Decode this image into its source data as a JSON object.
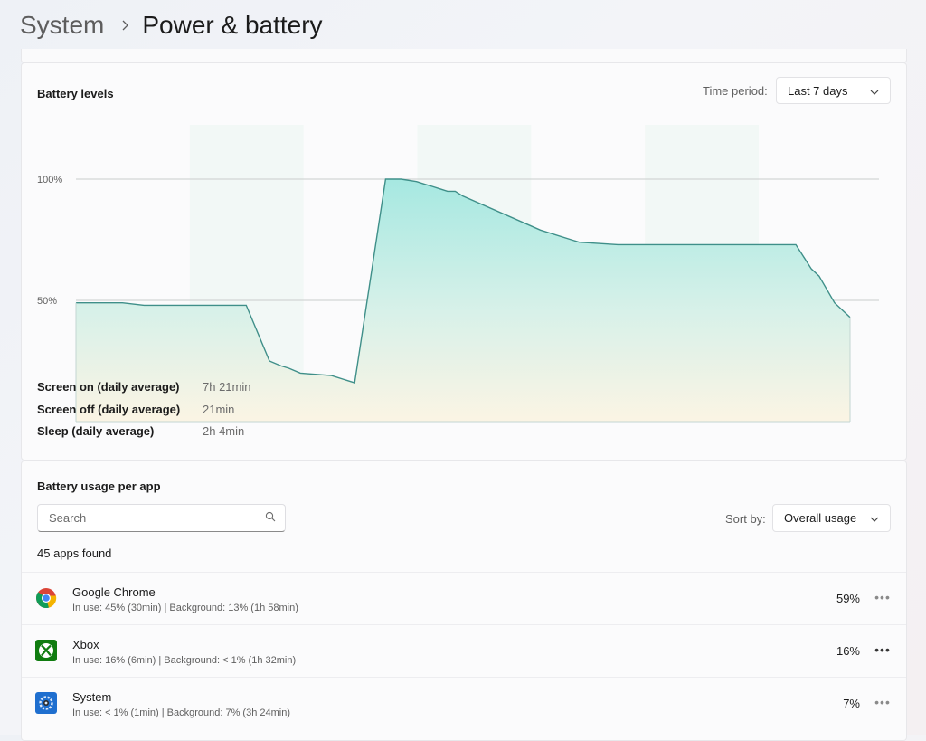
{
  "breadcrumb": {
    "parent": "System",
    "current": "Power & battery"
  },
  "levels": {
    "title": "Battery levels",
    "time_period_label": "Time period:",
    "time_period_value": "Last 7 days",
    "y_ticks": [
      "100%",
      "50%"
    ]
  },
  "chart_data": {
    "type": "area",
    "title": "Battery levels",
    "xlabel": "",
    "ylabel": "",
    "ylim": [
      0,
      100
    ],
    "y_ticks": [
      50,
      100
    ],
    "y_tick_labels": [
      "50%",
      "100%"
    ],
    "x": [
      0,
      6,
      8.8,
      9.5,
      12,
      15,
      20,
      22,
      25,
      26.5,
      27.5,
      29,
      33,
      36,
      40,
      42,
      44,
      45,
      46,
      47,
      48,
      49,
      50,
      60,
      65,
      70,
      75,
      80,
      85,
      90,
      91.5,
      93,
      95,
      96,
      98,
      100
    ],
    "series": [
      {
        "values": [
          49,
          49,
          48,
          48,
          48,
          48,
          48,
          48,
          25,
          23,
          22,
          20,
          19,
          16,
          100,
          100,
          99,
          98,
          97,
          96,
          95,
          95,
          93,
          79,
          74,
          73,
          73,
          73,
          73,
          73,
          73,
          73,
          63,
          60,
          49,
          43
        ],
        "color": "#3f8f89"
      }
    ],
    "grid": true,
    "shaded_bands": [
      [
        14.7,
        29.4
      ],
      [
        44.1,
        58.8
      ],
      [
        73.5,
        88.2
      ]
    ]
  },
  "stats": [
    {
      "label": "Screen on (daily average)",
      "value": "7h 21min"
    },
    {
      "label": "Screen off (daily average)",
      "value": "21min"
    },
    {
      "label": "Sleep (daily average)",
      "value": "2h 4min"
    }
  ],
  "usage": {
    "title": "Battery usage per app",
    "search_placeholder": "Search",
    "sort_label": "Sort by:",
    "sort_value": "Overall usage",
    "count_text": "45 apps found",
    "apps": [
      {
        "name": "Google Chrome",
        "detail": "In use: 45% (30min) | Background: 13% (1h 58min)",
        "percent": "59%",
        "icon": "chrome-icon"
      },
      {
        "name": "Xbox",
        "detail": "In use: 16% (6min) | Background: < 1% (1h 32min)",
        "percent": "16%",
        "icon": "xbox-icon"
      },
      {
        "name": "System",
        "detail": "In use: < 1% (1min) | Background: 7% (3h 24min)",
        "percent": "7%",
        "icon": "system-icon"
      }
    ]
  },
  "colors": {
    "accent_line": "#3f8f89",
    "area_top": "#a6e8e1",
    "area_bottom": "#fbf4e4"
  }
}
